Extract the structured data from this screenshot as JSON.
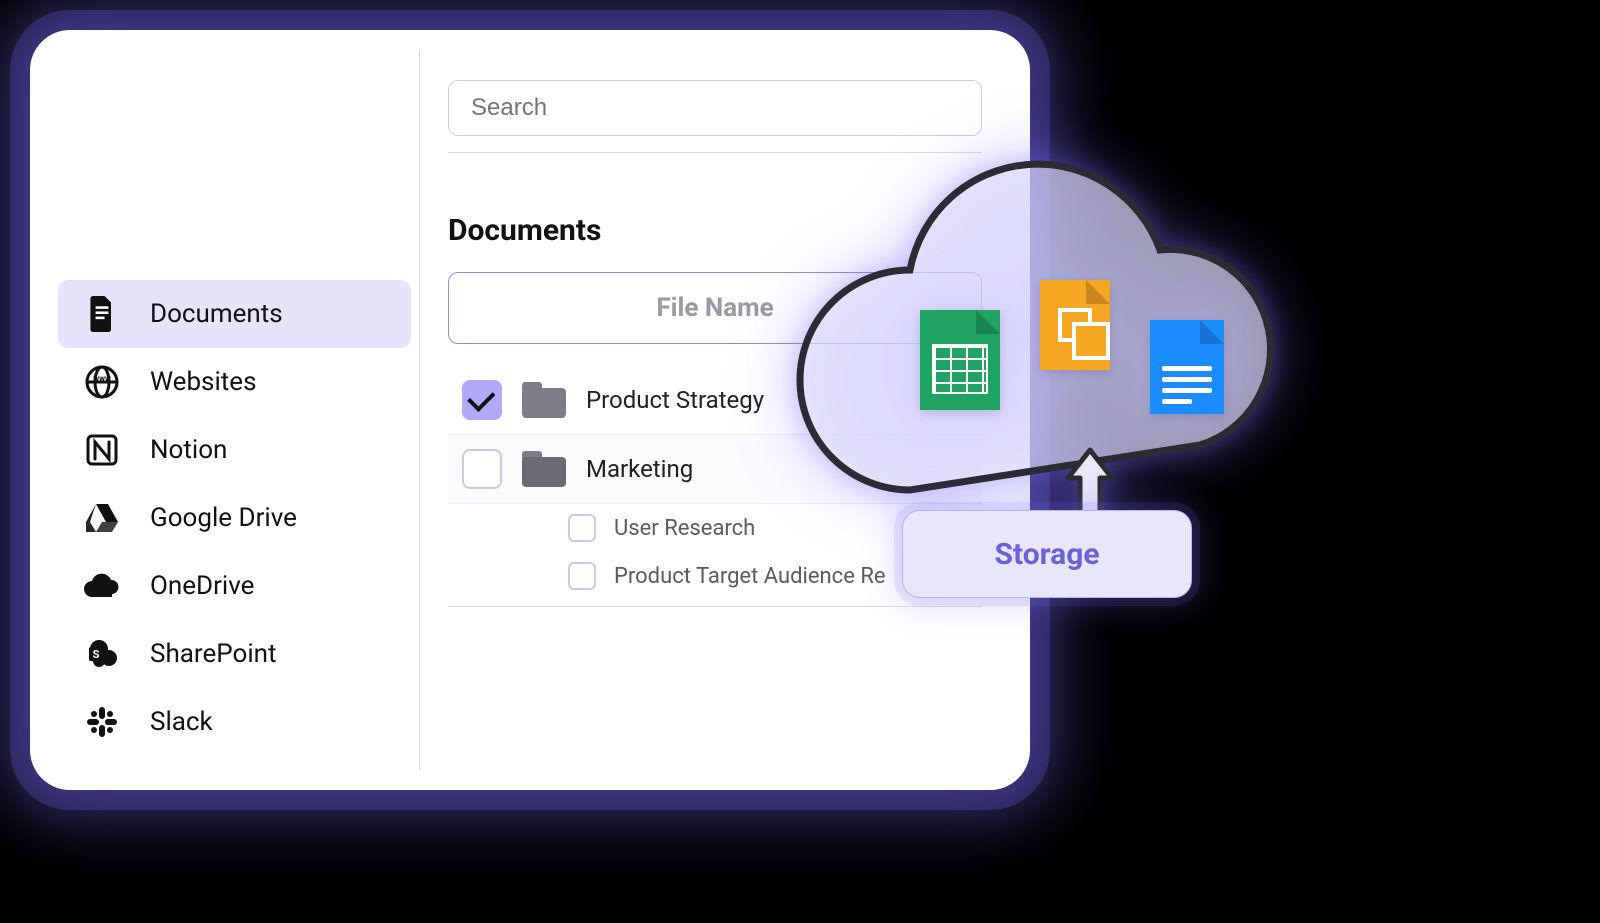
{
  "search": {
    "placeholder": "Search"
  },
  "sidebar": {
    "items": [
      {
        "label": "Documents",
        "icon": "document-icon",
        "active": true
      },
      {
        "label": "Websites",
        "icon": "www-icon"
      },
      {
        "label": "Notion",
        "icon": "notion-icon"
      },
      {
        "label": "Google Drive",
        "icon": "google-drive-icon"
      },
      {
        "label": "OneDrive",
        "icon": "onedrive-icon"
      },
      {
        "label": "SharePoint",
        "icon": "sharepoint-icon"
      },
      {
        "label": "Slack",
        "icon": "slack-icon"
      }
    ]
  },
  "main": {
    "title": "Documents",
    "column_header": "File Name",
    "rows": [
      {
        "name": "Product Strategy",
        "checked": true,
        "open": false
      },
      {
        "name": "Marketing",
        "checked": false,
        "open": true,
        "children": [
          {
            "name": "User Research",
            "checked": false
          },
          {
            "name": "Product Target Audience Re",
            "checked": false
          }
        ]
      }
    ]
  },
  "storage_label": "Storage",
  "colors": {
    "accent": "#6a62d8",
    "glow": "#786eff",
    "sheets": "#1fa463",
    "slides": "#f5a623",
    "docs": "#1a8cff"
  }
}
